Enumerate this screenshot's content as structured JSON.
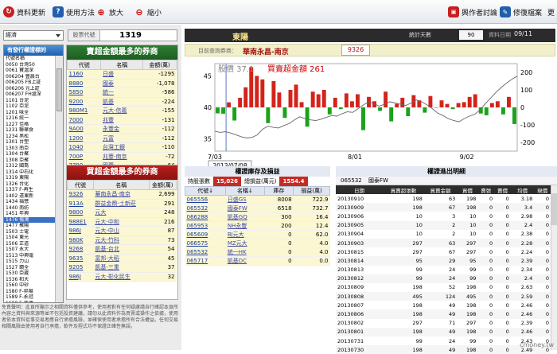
{
  "toolbar": {
    "update": "資料更新",
    "help": "使用方法",
    "zoom_in": "放大",
    "zoom_out": "縮小",
    "forum": "興作者討論",
    "repair": "修復檔案",
    "more": "更"
  },
  "left": {
    "select_value": "經濟",
    "code_label": "股票代號",
    "code_value": "1319",
    "brokers_header": "有發行權證標的",
    "brokers": [
      "代號名稱",
      "0050 台灣50",
      "0061 寶滬深",
      "006204 豐晨台",
      "006205 FB上証",
      "006206 元上証",
      "006207 FH滬深",
      "1101 台泥",
      "1102 亞泥",
      "1201 味全",
      "1216 統一",
      "1227 佳格",
      "1231 聯華食",
      "1234 黑松",
      "1301 台塑",
      "1303 南亞",
      "1304 台聚",
      "1308 亞聚",
      "1312 國喬",
      "1314 中石化",
      "1319 東陽",
      "1326 台化",
      "1337 F-再生",
      "1402 遠東新",
      "1434 福懋",
      "1440 南紡",
      "1451 年興",
      "1476 儒鴻",
      "1477 聚陽",
      "1503 士電",
      "1504 東元",
      "1506 正道",
      "1507 永大",
      "1513 中興電",
      "1515 力山",
      "1527 鑽全",
      "1530 亞崴",
      "1536 和大",
      "1560 中砂",
      "1580 F-昇陽",
      "1589 F-永冠",
      "1590 F-亞德",
      "1605 華新",
      "1701 中化",
      "1702 南僑"
    ],
    "broker_selected": "1476 儒鴻",
    "green_title": "賣超金額最多的券商",
    "green_headers": [
      "代號",
      "名稱",
      "金額(萬)"
    ],
    "green_rows": [
      [
        "1160",
        "日盛",
        "-1295"
      ],
      [
        "8880",
        "國泰",
        "-1,078"
      ],
      [
        "5850",
        "統一",
        "-586"
      ],
      [
        "9200",
        "凱基",
        "-224"
      ],
      [
        "980M1",
        "元大-信義",
        "-155"
      ],
      [
        "7000",
        "兆豐",
        "-131"
      ],
      [
        "9A00",
        "永豐金",
        "-112"
      ],
      [
        "1200",
        "元富",
        "-112"
      ],
      [
        "1040",
        "台灣工銀",
        "-110"
      ],
      [
        "700P",
        "兆豐-南京",
        "-72"
      ],
      [
        "7790",
        "國票",
        "-64"
      ]
    ],
    "red_title": "買超金額最多的券商",
    "red_headers": [
      "代號",
      "名稱",
      "金額(萬)"
    ],
    "red_rows": [
      [
        "9326",
        "華南永昌-南京",
        "2,699"
      ],
      [
        "913A",
        "群益金鼎-土新莊",
        "291"
      ],
      [
        "9800",
        "元大",
        "248"
      ],
      [
        "988E1",
        "元大-中和",
        "216"
      ],
      [
        "986J",
        "元大-中山",
        "87"
      ],
      [
        "980K",
        "元大-竹科",
        "73"
      ],
      [
        "9268",
        "凱基-台北",
        "54"
      ],
      [
        "9635",
        "富邦-大稻",
        "45"
      ],
      [
        "9205",
        "凱基-三重",
        "37"
      ],
      [
        "986J",
        "元大-彰化民生",
        "32"
      ]
    ],
    "disclaimer": "免責聲明：此頁所顯示之相關資料僅供參考，使用者對有任何疑慮請自行確認本頁所內容之資料與來源等並不包括投資建議，請勿以此資料作為買賣或操作之依據，使用者依本資料從事交易者應自行承擔風險，並確保使用者承擔所有合法權益。任何交易相關風險由使用者自行承擔，軟件及程式均不保證正確性無誤。"
  },
  "right": {
    "stock_name": "東陽",
    "days_label": "統計天數",
    "days_value": "90",
    "date_label": "資料日期",
    "date_value": "09/11",
    "broker_label": "目前查詢券商：",
    "broker_name": "華南永昌-南京",
    "broker_code": "9326",
    "hold_title": "權證庫存及損益",
    "hold_qty_label": "持股張數",
    "hold_qty": "15,026",
    "hold_pl_label": "總損益(萬元)",
    "hold_pl": "1554.4",
    "hold_headers": [
      "代號↓",
      "名稱↓",
      "庫存",
      "損益(萬)"
    ],
    "hold_rows": [
      [
        "065556",
        "日盛GS",
        "8008",
        "722.9"
      ],
      [
        "065532",
        "國泰FW",
        "6518",
        "732.7"
      ],
      [
        "066288",
        "凱基GQ",
        "300",
        "16.4"
      ],
      [
        "065953",
        "NH永豐",
        "200",
        "12.4"
      ],
      [
        "065609",
        "BJ元大",
        "0",
        "62.0"
      ],
      [
        "066575",
        "MZ元大",
        "0",
        "4.0"
      ],
      [
        "065532",
        "統一HK",
        "0",
        "4.0"
      ],
      [
        "065717",
        "凱基DC",
        "0",
        "0.0"
      ]
    ],
    "trade_title": "權證進出明細",
    "trade_code": "065532",
    "trade_name": "國泰FW",
    "trade_headers": [
      "日期",
      "買賣超張數",
      "買賣金額",
      "買價",
      "賣張",
      "賣價",
      "均價",
      "現價"
    ],
    "trade_rows": [
      [
        "20130910",
        "198",
        "63",
        "198",
        "0",
        "0",
        "3.18",
        "0"
      ],
      [
        "20130909",
        "198",
        "67",
        "198",
        "0",
        "0",
        "3.4",
        "0"
      ],
      [
        "20130906",
        "10",
        "3",
        "10",
        "0",
        "0",
        "2.98",
        "0"
      ],
      [
        "20130905",
        "10",
        "2",
        "10",
        "0",
        "0",
        "2.4",
        "0"
      ],
      [
        "20130904",
        "10",
        "2",
        "10",
        "0",
        "0",
        "2.38",
        "0"
      ],
      [
        "20130903",
        "297",
        "63",
        "297",
        "0",
        "0",
        "2.28",
        "0"
      ],
      [
        "20130815",
        "297",
        "67",
        "297",
        "0",
        "0",
        "2.24",
        "0"
      ],
      [
        "20130814",
        "95",
        "29",
        "95",
        "0",
        "0",
        "2.39",
        "0"
      ],
      [
        "20130813",
        "99",
        "24",
        "99",
        "0",
        "0",
        "2.34",
        "0"
      ],
      [
        "20130812",
        "99",
        "24",
        "99",
        "0",
        "0",
        "2.4",
        "0"
      ],
      [
        "20130809",
        "198",
        "52",
        "198",
        "0",
        "0",
        "2.63",
        "0"
      ],
      [
        "20130808",
        "495",
        "124",
        "495",
        "0",
        "0",
        "2.59",
        "0"
      ],
      [
        "20130807",
        "198",
        "49",
        "198",
        "0",
        "0",
        "2.46",
        "0"
      ],
      [
        "20130806",
        "198",
        "49",
        "198",
        "0",
        "0",
        "2.46",
        "0"
      ],
      [
        "20130802",
        "297",
        "71",
        "297",
        "0",
        "0",
        "2.39",
        "0"
      ],
      [
        "20130801",
        "198",
        "49",
        "198",
        "0",
        "0",
        "2.46",
        "0"
      ],
      [
        "20130731",
        "99",
        "24",
        "99",
        "0",
        "0",
        "2.43",
        "0"
      ],
      [
        "20130730",
        "198",
        "49",
        "198",
        "0",
        "0",
        "2.49",
        "0"
      ]
    ],
    "watermark": "cmoney.tw"
  },
  "chart_data": {
    "type": "bar",
    "title": "",
    "price_label": "股價 37.1",
    "amount_label": "買賣超金額 261",
    "x_ticks": [
      "7/03",
      "8/01",
      "9/02"
    ],
    "y_left_ticks": [
      "45",
      "40",
      "35"
    ],
    "y_right_ticks": [
      "200",
      "100",
      "0",
      "-100",
      "-200"
    ],
    "ylim_left": [
      33,
      47
    ],
    "ylim_right": [
      -250,
      250
    ],
    "cursor_date": "2013/07/08",
    "price": [
      36.2,
      36.0,
      36.1,
      35.9,
      35.6,
      35.3,
      35.1,
      35.2,
      35.6,
      36.5,
      37.0,
      36.8,
      36.7,
      37.1,
      37.4,
      38.0,
      38.5,
      38.2,
      38.0,
      37.9,
      38.1,
      38.4,
      38.7,
      38.6,
      39.0,
      39.3,
      39.2,
      39.8,
      40.4,
      40.9,
      40.6,
      40.2,
      40.5,
      40.9,
      40.7,
      40.5,
      40.3,
      40.7,
      41.2,
      40.9,
      40.4,
      39.8,
      39.1,
      38.7,
      38.2,
      37.9,
      37.7,
      38.2,
      38.6,
      38.9,
      39.6,
      40.6,
      41.5,
      42.4,
      43.2,
      43.9,
      44.5,
      45.0
    ],
    "amounts": [
      -34,
      -36,
      29,
      -75,
      55,
      115,
      230,
      180,
      160,
      -90,
      150,
      85,
      -60,
      100,
      130,
      30,
      -110,
      90,
      75,
      100,
      -40,
      55,
      -10,
      80,
      35,
      75,
      -130,
      60,
      35,
      -20,
      90,
      -80,
      20,
      55,
      -50,
      70,
      40,
      -30,
      65,
      0,
      40,
      20,
      -10,
      25,
      30,
      60,
      75,
      -35,
      -45,
      25,
      35,
      -40,
      60,
      -95
    ]
  }
}
